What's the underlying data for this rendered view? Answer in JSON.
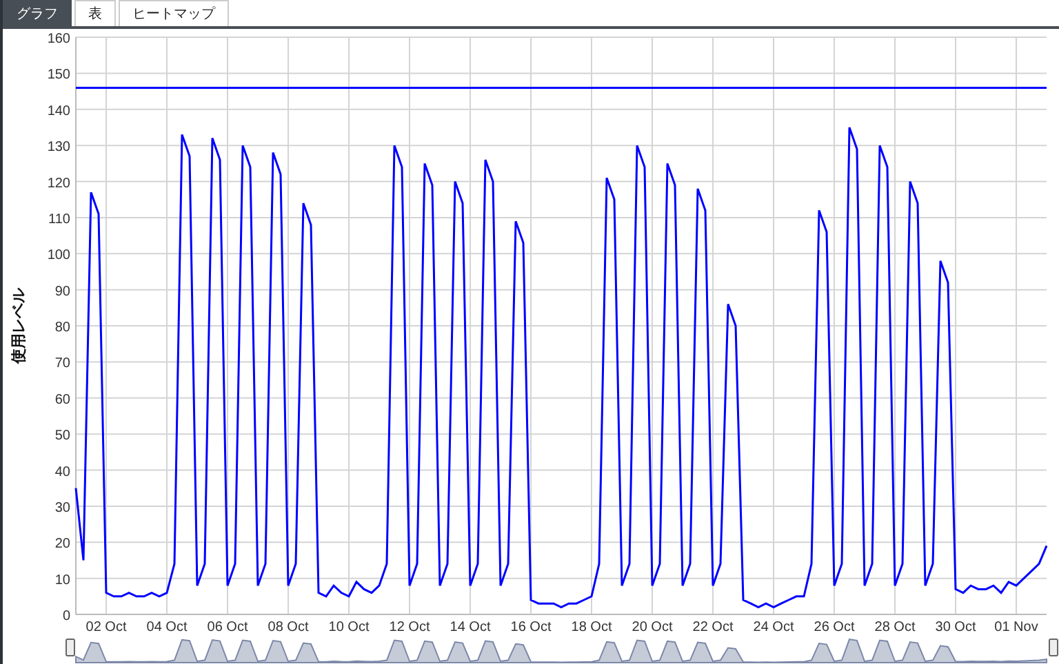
{
  "tabs": [
    {
      "label": "グラフ",
      "selected": true
    },
    {
      "label": "表",
      "selected": false
    },
    {
      "label": "ヒートマップ",
      "selected": false
    }
  ],
  "chart": {
    "chart_data": {
      "type": "line",
      "ylabel": "使用レベル",
      "ylim": [
        0,
        160
      ],
      "yticks": [
        0,
        10,
        20,
        30,
        40,
        50,
        60,
        70,
        80,
        90,
        100,
        110,
        120,
        130,
        140,
        150,
        160
      ],
      "categories": [
        null,
        null,
        null,
        null,
        "02 Oct",
        null,
        null,
        null,
        null,
        null,
        null,
        null,
        "04 Oct",
        null,
        null,
        null,
        null,
        null,
        null,
        null,
        "06 Oct",
        null,
        null,
        null,
        null,
        null,
        null,
        null,
        "08 Oct",
        null,
        null,
        null,
        null,
        null,
        null,
        null,
        "10 Oct",
        null,
        null,
        null,
        null,
        null,
        null,
        null,
        "12 Oct",
        null,
        null,
        null,
        null,
        null,
        null,
        null,
        "14 Oct",
        null,
        null,
        null,
        null,
        null,
        null,
        null,
        "16 Oct",
        null,
        null,
        null,
        null,
        null,
        null,
        null,
        "18 Oct",
        null,
        null,
        null,
        null,
        null,
        null,
        null,
        "20 Oct",
        null,
        null,
        null,
        null,
        null,
        null,
        null,
        "22 Oct",
        null,
        null,
        null,
        null,
        null,
        null,
        null,
        "24 Oct",
        null,
        null,
        null,
        null,
        null,
        null,
        null,
        "26 Oct",
        null,
        null,
        null,
        null,
        null,
        null,
        null,
        "28 Oct",
        null,
        null,
        null,
        null,
        null,
        null,
        null,
        "30 Oct",
        null,
        null,
        null,
        null,
        null,
        null,
        null,
        "01 Nov",
        null,
        null,
        null,
        null
      ],
      "series": [
        {
          "color": "#0000ff",
          "values": [
            35,
            15,
            117,
            111,
            6,
            5,
            5,
            6,
            5,
            5,
            6,
            5,
            6,
            14,
            133,
            127,
            8,
            14,
            132,
            126,
            8,
            14,
            130,
            124,
            8,
            14,
            128,
            122,
            8,
            14,
            114,
            108,
            6,
            5,
            8,
            6,
            5,
            9,
            7,
            6,
            8,
            14,
            130,
            124,
            8,
            14,
            125,
            119,
            8,
            14,
            120,
            114,
            8,
            14,
            126,
            120,
            8,
            14,
            109,
            103,
            4,
            3,
            3,
            3,
            2,
            3,
            3,
            4,
            5,
            14,
            121,
            115,
            8,
            14,
            130,
            124,
            8,
            14,
            125,
            119,
            8,
            14,
            118,
            112,
            8,
            14,
            86,
            80,
            4,
            3,
            2,
            3,
            2,
            3,
            4,
            5,
            5,
            14,
            112,
            106,
            8,
            14,
            135,
            129,
            8,
            14,
            130,
            124,
            8,
            14,
            120,
            114,
            8,
            14,
            98,
            92,
            7,
            6,
            8,
            7,
            7,
            8,
            6,
            9,
            8,
            10,
            12,
            14,
            19
          ]
        },
        {
          "color": "#0000ff",
          "values": [
            146,
            146,
            146,
            146,
            146,
            146,
            146,
            146,
            146,
            146,
            146,
            146,
            146,
            146,
            146,
            146,
            146,
            146,
            146,
            146,
            146,
            146,
            146,
            146,
            146,
            146,
            146,
            146,
            146,
            146,
            146,
            146,
            146,
            146,
            146,
            146,
            146,
            146,
            146,
            146,
            146,
            146,
            146,
            146,
            146,
            146,
            146,
            146,
            146,
            146,
            146,
            146,
            146,
            146,
            146,
            146,
            146,
            146,
            146,
            146,
            146,
            146,
            146,
            146,
            146,
            146,
            146,
            146,
            146,
            146,
            146,
            146,
            146,
            146,
            146,
            146,
            146,
            146,
            146,
            146,
            146,
            146,
            146,
            146,
            146,
            146,
            146,
            146,
            146,
            146,
            146,
            146,
            146,
            146,
            146,
            146,
            146,
            146,
            146,
            146,
            146,
            146,
            146,
            146,
            146,
            146,
            146,
            146,
            146,
            146,
            146,
            146,
            146,
            146,
            146,
            146,
            146,
            146,
            146,
            146,
            146,
            146,
            146,
            146,
            146,
            146,
            146,
            146,
            146
          ]
        }
      ],
      "grid": true
    }
  }
}
